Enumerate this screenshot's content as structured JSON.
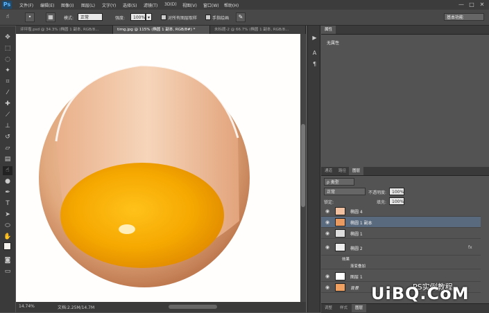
{
  "app": {
    "logo": "Ps"
  },
  "menu": [
    "文件(F)",
    "编辑(E)",
    "图像(I)",
    "图层(L)",
    "文字(Y)",
    "选择(S)",
    "滤镜(T)",
    "3D(D)",
    "视图(V)",
    "窗口(W)",
    "帮助(H)"
  ],
  "window_controls": [
    "—",
    "□",
    "✕"
  ],
  "options": {
    "mode_label": "模式:",
    "mode_value": "正常",
    "strength_label": "强度:",
    "strength_value": "100%",
    "sample_all_label": "对所有图层取样",
    "finger_paint_label": "手指绘画",
    "workspace": "基本功能"
  },
  "tabs": [
    "评坪塩.psd @ 34.3% (椭圆 1 副本, RGB/8...",
    "timg.jpg @ 115% (椭圆 1 副本, RGB/8#) *",
    "未标题-2 @ 66.7% (椭圆 1 副本, RGB/8..."
  ],
  "tab_close": "×",
  "status": {
    "zoom": "14.74%",
    "doc": "文档:2.25M/14.7M"
  },
  "properties": {
    "tab": "属性",
    "content": "无属性"
  },
  "layers": {
    "tabs": [
      "通道",
      "路径",
      "图层"
    ],
    "kind_filter": "ρ 类型",
    "blend_mode": "正常",
    "opacity_label": "不透明度:",
    "opacity_value": "100%",
    "lock_label": "锁定:",
    "fill_label": "填充:",
    "fill_value": "100%",
    "items": [
      {
        "name": "椭圆 4",
        "selected": false
      },
      {
        "name": "椭圆 1 副本",
        "selected": true
      },
      {
        "name": "椭圆 1",
        "selected": false
      },
      {
        "name": "椭圆 2",
        "selected": false,
        "fx": "fx"
      },
      {
        "name": "效果",
        "sub": true
      },
      {
        "name": "渐变叠加",
        "sub": true
      },
      {
        "name": "图层 1",
        "selected": false
      },
      {
        "name": "背景",
        "selected": false
      }
    ]
  },
  "bottom_tabs": [
    "调整",
    "样式",
    "图层"
  ],
  "watermark": {
    "text1": "PS实例教程",
    "text2": "UiBQ.CoM"
  },
  "colors": {
    "accent": "#1e4a6e",
    "selected_layer": "#5a6a7e",
    "yolk": "#f5a800",
    "shell": "#d89a70"
  }
}
